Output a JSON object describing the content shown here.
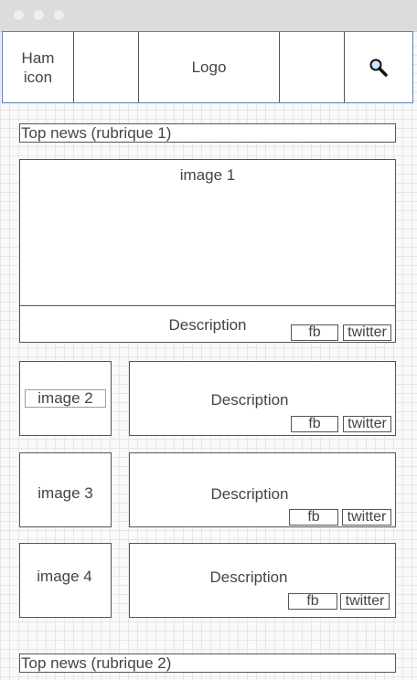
{
  "header": {
    "menu_label": "Ham\nicon",
    "logo": "Logo",
    "search_icon": "search-icon"
  },
  "sections": [
    {
      "title": "Top news (rubrique 1)"
    },
    {
      "title": "Top news (rubrique 2)"
    }
  ],
  "featured": {
    "image_label": "image 1",
    "description": "Description",
    "fb": "fb",
    "twitter": "twitter"
  },
  "articles": [
    {
      "image_label": "image 2",
      "description": "Description",
      "fb": "fb",
      "twitter": "twitter"
    },
    {
      "image_label": "image 3",
      "description": "Description",
      "fb": "fb",
      "twitter": "twitter"
    },
    {
      "image_label": "image 4",
      "description": "Description",
      "fb": "fb",
      "twitter": "twitter"
    }
  ]
}
